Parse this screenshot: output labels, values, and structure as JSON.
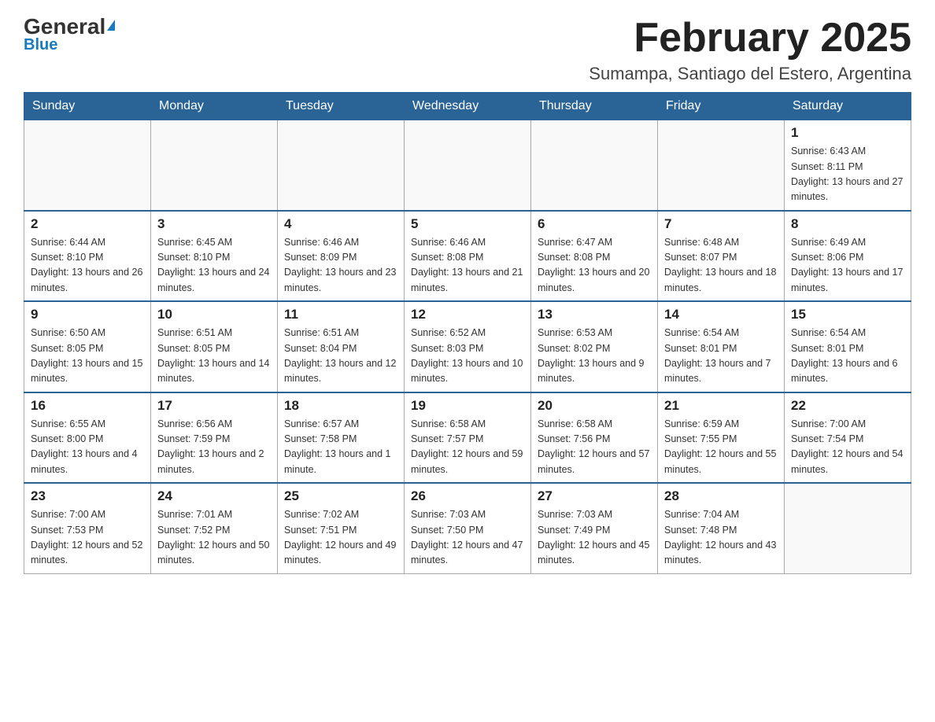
{
  "header": {
    "logo_general": "General",
    "logo_blue": "Blue",
    "month_title": "February 2025",
    "location": "Sumampa, Santiago del Estero, Argentina"
  },
  "days_of_week": [
    "Sunday",
    "Monday",
    "Tuesday",
    "Wednesday",
    "Thursday",
    "Friday",
    "Saturday"
  ],
  "weeks": [
    {
      "days": [
        {
          "number": "",
          "info": ""
        },
        {
          "number": "",
          "info": ""
        },
        {
          "number": "",
          "info": ""
        },
        {
          "number": "",
          "info": ""
        },
        {
          "number": "",
          "info": ""
        },
        {
          "number": "",
          "info": ""
        },
        {
          "number": "1",
          "info": "Sunrise: 6:43 AM\nSunset: 8:11 PM\nDaylight: 13 hours and 27 minutes."
        }
      ]
    },
    {
      "days": [
        {
          "number": "2",
          "info": "Sunrise: 6:44 AM\nSunset: 8:10 PM\nDaylight: 13 hours and 26 minutes."
        },
        {
          "number": "3",
          "info": "Sunrise: 6:45 AM\nSunset: 8:10 PM\nDaylight: 13 hours and 24 minutes."
        },
        {
          "number": "4",
          "info": "Sunrise: 6:46 AM\nSunset: 8:09 PM\nDaylight: 13 hours and 23 minutes."
        },
        {
          "number": "5",
          "info": "Sunrise: 6:46 AM\nSunset: 8:08 PM\nDaylight: 13 hours and 21 minutes."
        },
        {
          "number": "6",
          "info": "Sunrise: 6:47 AM\nSunset: 8:08 PM\nDaylight: 13 hours and 20 minutes."
        },
        {
          "number": "7",
          "info": "Sunrise: 6:48 AM\nSunset: 8:07 PM\nDaylight: 13 hours and 18 minutes."
        },
        {
          "number": "8",
          "info": "Sunrise: 6:49 AM\nSunset: 8:06 PM\nDaylight: 13 hours and 17 minutes."
        }
      ]
    },
    {
      "days": [
        {
          "number": "9",
          "info": "Sunrise: 6:50 AM\nSunset: 8:05 PM\nDaylight: 13 hours and 15 minutes."
        },
        {
          "number": "10",
          "info": "Sunrise: 6:51 AM\nSunset: 8:05 PM\nDaylight: 13 hours and 14 minutes."
        },
        {
          "number": "11",
          "info": "Sunrise: 6:51 AM\nSunset: 8:04 PM\nDaylight: 13 hours and 12 minutes."
        },
        {
          "number": "12",
          "info": "Sunrise: 6:52 AM\nSunset: 8:03 PM\nDaylight: 13 hours and 10 minutes."
        },
        {
          "number": "13",
          "info": "Sunrise: 6:53 AM\nSunset: 8:02 PM\nDaylight: 13 hours and 9 minutes."
        },
        {
          "number": "14",
          "info": "Sunrise: 6:54 AM\nSunset: 8:01 PM\nDaylight: 13 hours and 7 minutes."
        },
        {
          "number": "15",
          "info": "Sunrise: 6:54 AM\nSunset: 8:01 PM\nDaylight: 13 hours and 6 minutes."
        }
      ]
    },
    {
      "days": [
        {
          "number": "16",
          "info": "Sunrise: 6:55 AM\nSunset: 8:00 PM\nDaylight: 13 hours and 4 minutes."
        },
        {
          "number": "17",
          "info": "Sunrise: 6:56 AM\nSunset: 7:59 PM\nDaylight: 13 hours and 2 minutes."
        },
        {
          "number": "18",
          "info": "Sunrise: 6:57 AM\nSunset: 7:58 PM\nDaylight: 13 hours and 1 minute."
        },
        {
          "number": "19",
          "info": "Sunrise: 6:58 AM\nSunset: 7:57 PM\nDaylight: 12 hours and 59 minutes."
        },
        {
          "number": "20",
          "info": "Sunrise: 6:58 AM\nSunset: 7:56 PM\nDaylight: 12 hours and 57 minutes."
        },
        {
          "number": "21",
          "info": "Sunrise: 6:59 AM\nSunset: 7:55 PM\nDaylight: 12 hours and 55 minutes."
        },
        {
          "number": "22",
          "info": "Sunrise: 7:00 AM\nSunset: 7:54 PM\nDaylight: 12 hours and 54 minutes."
        }
      ]
    },
    {
      "days": [
        {
          "number": "23",
          "info": "Sunrise: 7:00 AM\nSunset: 7:53 PM\nDaylight: 12 hours and 52 minutes."
        },
        {
          "number": "24",
          "info": "Sunrise: 7:01 AM\nSunset: 7:52 PM\nDaylight: 12 hours and 50 minutes."
        },
        {
          "number": "25",
          "info": "Sunrise: 7:02 AM\nSunset: 7:51 PM\nDaylight: 12 hours and 49 minutes."
        },
        {
          "number": "26",
          "info": "Sunrise: 7:03 AM\nSunset: 7:50 PM\nDaylight: 12 hours and 47 minutes."
        },
        {
          "number": "27",
          "info": "Sunrise: 7:03 AM\nSunset: 7:49 PM\nDaylight: 12 hours and 45 minutes."
        },
        {
          "number": "28",
          "info": "Sunrise: 7:04 AM\nSunset: 7:48 PM\nDaylight: 12 hours and 43 minutes."
        },
        {
          "number": "",
          "info": ""
        }
      ]
    }
  ]
}
